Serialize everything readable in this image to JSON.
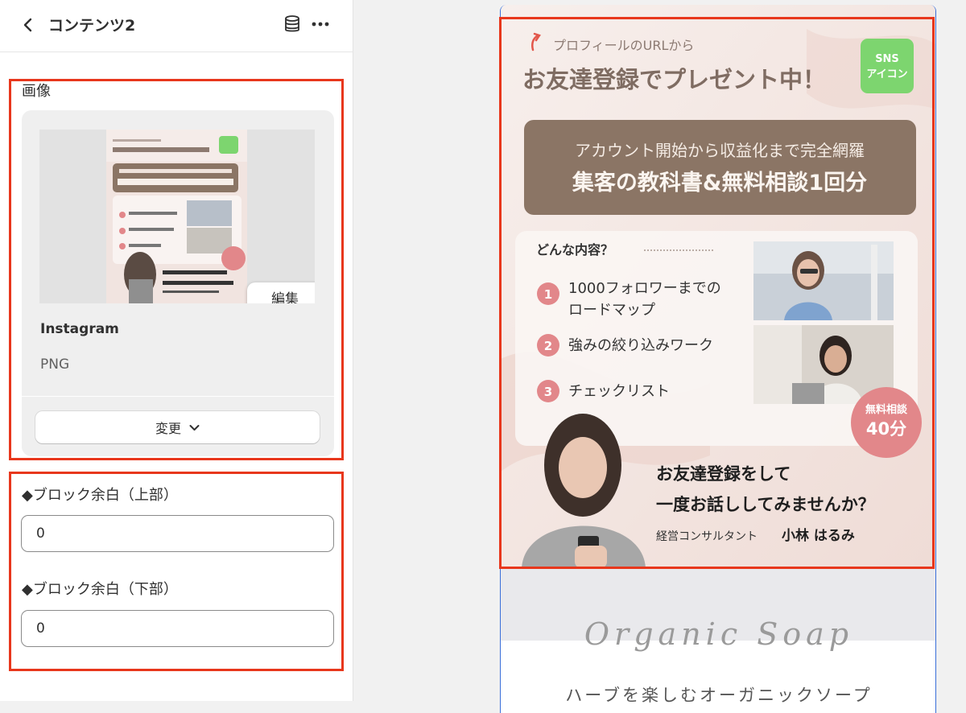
{
  "panel": {
    "title": "コンテンツ2",
    "back_icon": "chevron-left-icon",
    "db_icon": "database-icon",
    "more_icon": "ellipsis-icon"
  },
  "image_section": {
    "label": "画像",
    "edit_label": "編集",
    "file_name": "Instagram",
    "file_type": "PNG",
    "change_label": "変更"
  },
  "margin_section": {
    "top_label": "◆ブロック余白（上部）",
    "top_value": "0",
    "bottom_label": "◆ブロック余白（下部）",
    "bottom_value": "0"
  },
  "banner": {
    "subtitle": "プロフィールのURLから",
    "headline": "お友達登録でプレゼント中！",
    "sns_line1": "SNS",
    "sns_line2": "アイコン",
    "box_line1": "アカウント開始から収益化まで完全網羅",
    "box_line2": "集客の教科書&無料相談1回分",
    "contents_label": "どんな内容？",
    "items": [
      {
        "num": "1",
        "line1": "1000フォロワーまでの",
        "line2": "ロードマップ"
      },
      {
        "num": "2",
        "line1": "強みの絞り込みワーク",
        "line2": ""
      },
      {
        "num": "3",
        "line1": "チェックリスト",
        "line2": ""
      }
    ],
    "badge_line1": "無料相談",
    "badge_line2": "40分",
    "cta_line1": "お友達登録をして",
    "cta_line2": "一度お話ししてみませんか？",
    "signature_role": "経営コンサルタント",
    "signature_name": "小林 はるみ"
  },
  "below": {
    "script_title": "Organic Soap",
    "subtitle": "ハーブを楽しむオーガニックソープ"
  },
  "colors": {
    "accent_red": "#e8371c",
    "banner_bg": "#f2e7e4",
    "box_brown": "#8b7565",
    "num_pink": "#e2878a",
    "sns_green": "#7dd56f"
  }
}
